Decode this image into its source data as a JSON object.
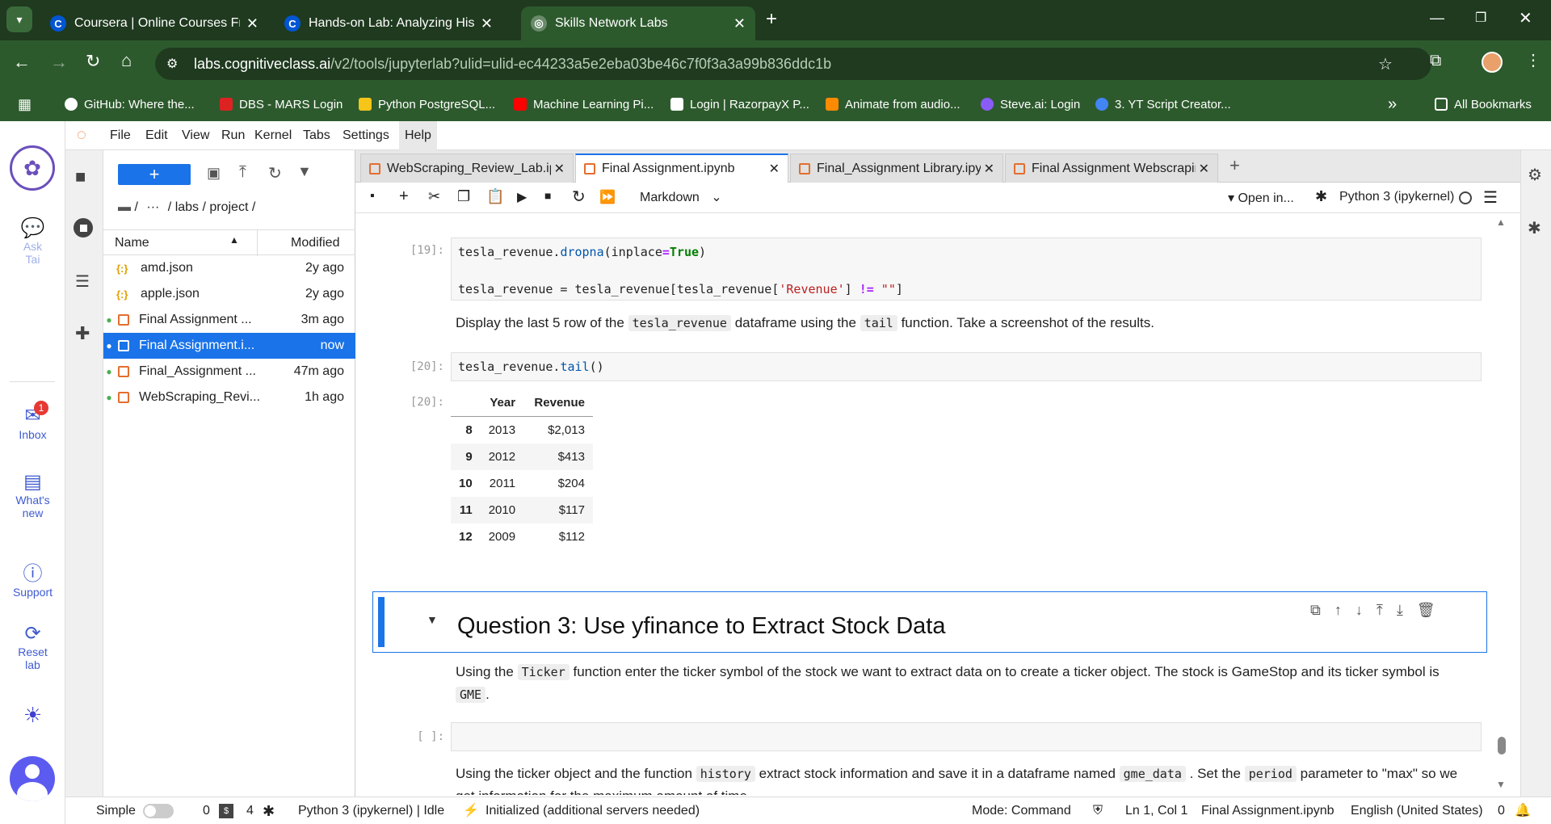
{
  "browser": {
    "tabs": [
      {
        "title": "Coursera | Online Courses From",
        "icon": "coursera-icon"
      },
      {
        "title": "Hands-on Lab: Analyzing Histor",
        "icon": "coursera-icon"
      },
      {
        "title": "Skills Network Labs",
        "icon": "skills-network-icon"
      }
    ],
    "url_host": "labs.cognitiveclass.ai",
    "url_path": "/v2/tools/jupyterlab?ulid=ulid-ec44233a5e2eba03be46c7f0f3a3a99b836ddc1b",
    "bookmarks": [
      "GitHub: Where the...",
      "DBS - MARS Login",
      "Python PostgreSQL...",
      "Machine Learning Pi...",
      "Login | RazorpayX P...",
      "Animate from audio...",
      "Steve.ai: Login",
      "3. YT Script Creator..."
    ],
    "all_bookmarks": "All Bookmarks",
    "more": "»"
  },
  "leftbar": {
    "ask_tai": "Ask Tai",
    "ask_tai_2": "Tai",
    "ask_tai_1": "Ask",
    "inbox": "Inbox",
    "inbox_badge": "1",
    "whats_new_1": "What's",
    "whats_new_2": "new",
    "support": "Support",
    "reset_1": "Reset",
    "reset_2": "lab"
  },
  "menu": [
    "File",
    "Edit",
    "View",
    "Run",
    "Kernel",
    "Tabs",
    "Settings",
    "Help"
  ],
  "files": {
    "new_button": "+",
    "breadcrumb_root": "/",
    "breadcrumb_more": "···",
    "breadcrumb_path": "/ labs / project /",
    "col_name": "Name",
    "col_modified": "Modified",
    "rows": [
      {
        "name": "amd.json",
        "modified": "2y ago",
        "type": "json",
        "running": false
      },
      {
        "name": "apple.json",
        "modified": "2y ago",
        "type": "json",
        "running": false
      },
      {
        "name": "Final Assignment ...",
        "modified": "3m ago",
        "type": "notebook",
        "running": true
      },
      {
        "name": "Final Assignment.i...",
        "modified": "now",
        "type": "notebook",
        "running": true
      },
      {
        "name": "Final_Assignment ...",
        "modified": "47m ago",
        "type": "notebook",
        "running": true
      },
      {
        "name": "WebScraping_Revi...",
        "modified": "1h ago",
        "type": "notebook",
        "running": true
      }
    ]
  },
  "doc_tabs": [
    "WebScraping_Review_Lab.ipy",
    "Final Assignment.ipynb",
    "Final_Assignment Library.ipyr",
    "Final Assignment Webscrapir"
  ],
  "nb_toolbar": {
    "cell_type": "Markdown",
    "open_in": "Open in...",
    "kernel": "Python 3 (ipykernel)"
  },
  "cells": {
    "c19_prompt": "[19]:",
    "c19_line1_var": "tesla_revenue",
    "c19_line1_fn": "dropna",
    "c19_line1_arg": "inplace",
    "c19_line1_true": "True",
    "c19_line2_a": "tesla_revenue = tesla_revenue[tesla_revenue[",
    "c19_line2_str": "'Revenue'",
    "c19_line2_op": "!=",
    "c19_line2_str2": "\"\"",
    "md1_a": "Display the last 5 row of the",
    "md1_code1": "tesla_revenue",
    "md1_b": "dataframe using the",
    "md1_code2": "tail",
    "md1_c": "function. Take a screenshot of the results.",
    "c20_prompt": "[20]:",
    "c20_var": "tesla_revenue",
    "c20_fn": "tail",
    "out20_prompt": "[20]:",
    "table": {
      "headers": [
        "",
        "Year",
        "Revenue"
      ],
      "rows": [
        [
          "8",
          "2013",
          "$2,013"
        ],
        [
          "9",
          "2012",
          "$413"
        ],
        [
          "10",
          "2011",
          "$204"
        ],
        [
          "11",
          "2010",
          "$117"
        ],
        [
          "12",
          "2009",
          "$112"
        ]
      ]
    },
    "q3_heading": "Question 3: Use yfinance to Extract Stock Data",
    "md2_a": "Using the",
    "md2_code1": "Ticker",
    "md2_b": "function enter the ticker symbol of the stock we want to extract data on to create a ticker object. The stock is GameStop and its ticker symbol",
    "md2_c": "is",
    "md2_code2": "GME",
    "md2_d": ".",
    "empty_prompt": "[ ]:",
    "md3_a": "Using the ticker object and the function",
    "md3_code1": "history",
    "md3_b": "extract stock information and save it in a dataframe named",
    "md3_code2": "gme_data",
    "md3_c": ". Set the",
    "md3_code3": "period",
    "md3_d": "parameter to",
    "md3_e": "\"max\" so we get information for the maximum amount of time."
  },
  "status": {
    "mode_label": "Simple",
    "count1": "0",
    "count2": "4",
    "kernel": "Python 3 (ipykernel) | Idle",
    "init": "Initialized (additional servers needed)",
    "mode": "Mode: Command",
    "position": "Ln 1, Col 1",
    "file": "Final Assignment.ipynb",
    "lang": "English (United States)",
    "notif": "0"
  }
}
